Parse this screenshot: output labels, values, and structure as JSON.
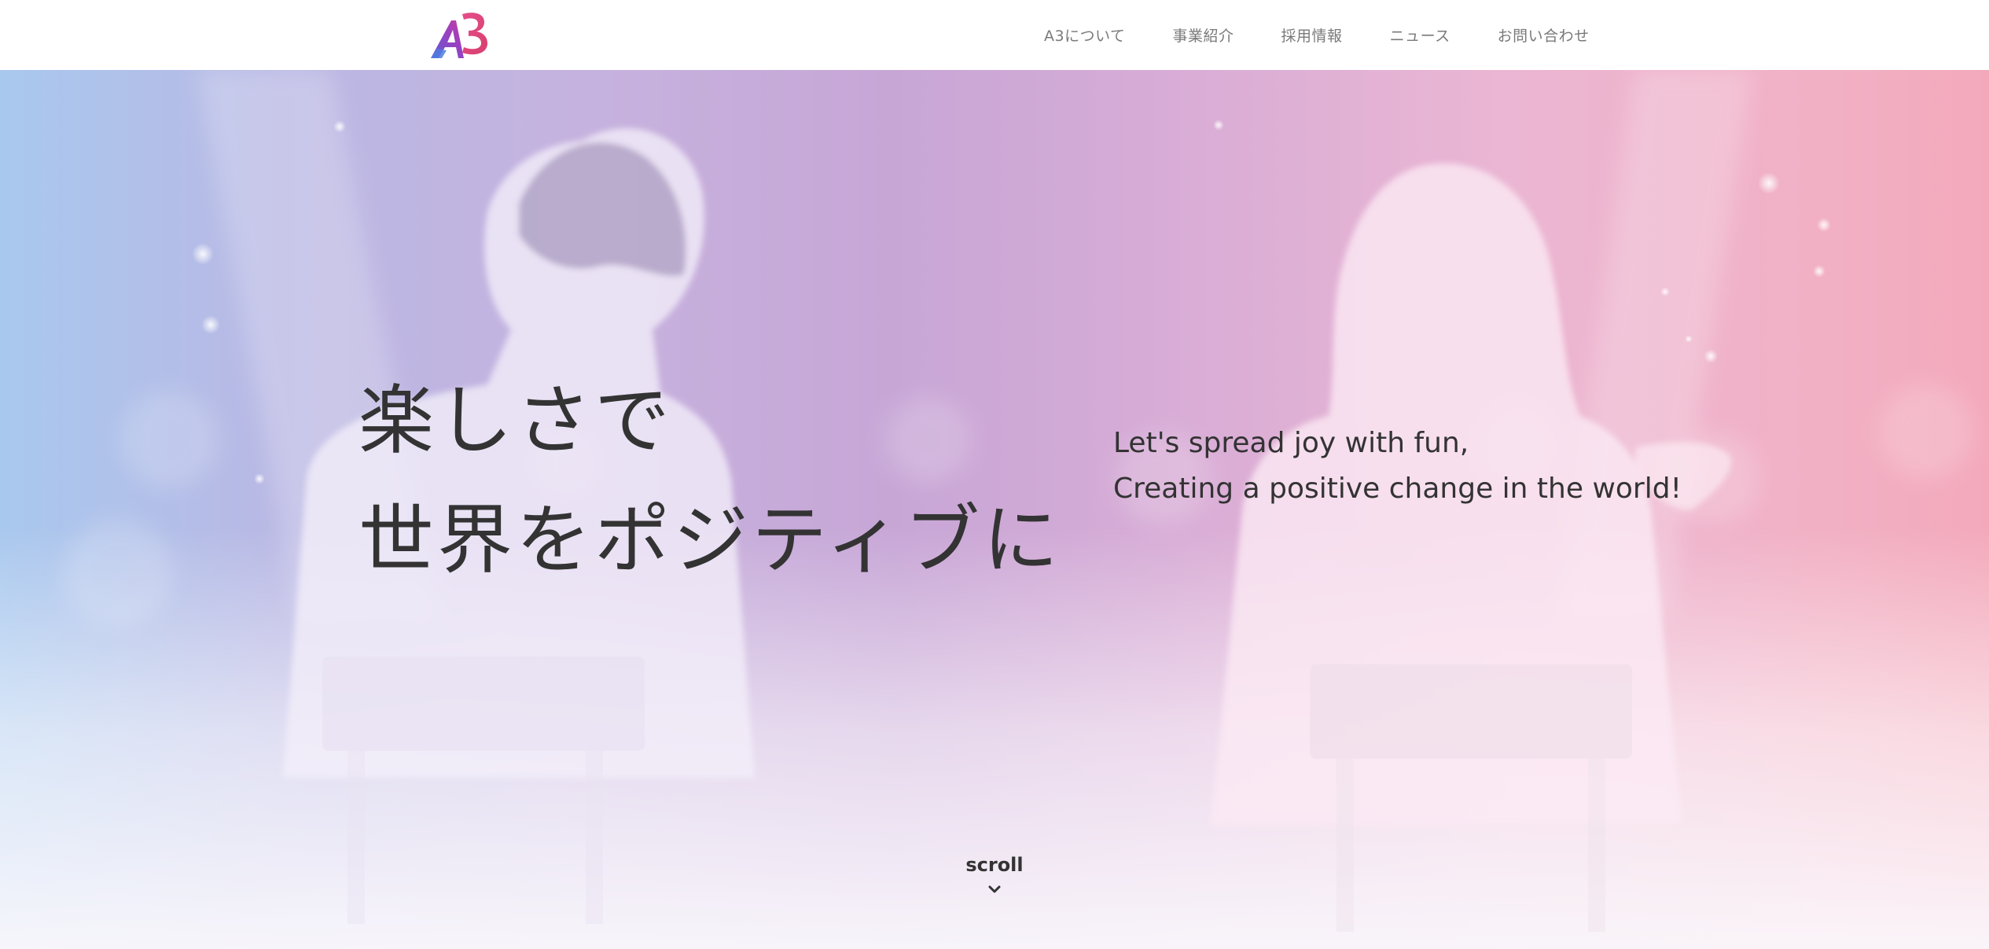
{
  "header": {
    "logo_text": "A3",
    "nav": [
      {
        "label": "A3について"
      },
      {
        "label": "事業紹介"
      },
      {
        "label": "採用情報"
      },
      {
        "label": "ニュース"
      },
      {
        "label": "お問い合わせ"
      }
    ]
  },
  "hero": {
    "headline": {
      "line1": "楽しさで",
      "line2": "世界をポジティブに"
    },
    "subline": {
      "line1": "Let's spread joy with fun,",
      "line2": "Creating a positive change in the world!"
    },
    "scroll_label": "scroll",
    "scroll_icon": "chevron-down-icon"
  },
  "colors": {
    "text": "#333333",
    "nav_text": "#7a7a7a",
    "logo_a": "#6b46c1",
    "logo_3": "#e0457b",
    "hero_left": "#a9c8ee",
    "hero_mid": "#c7a6d6",
    "hero_right": "#f3a9bb"
  }
}
